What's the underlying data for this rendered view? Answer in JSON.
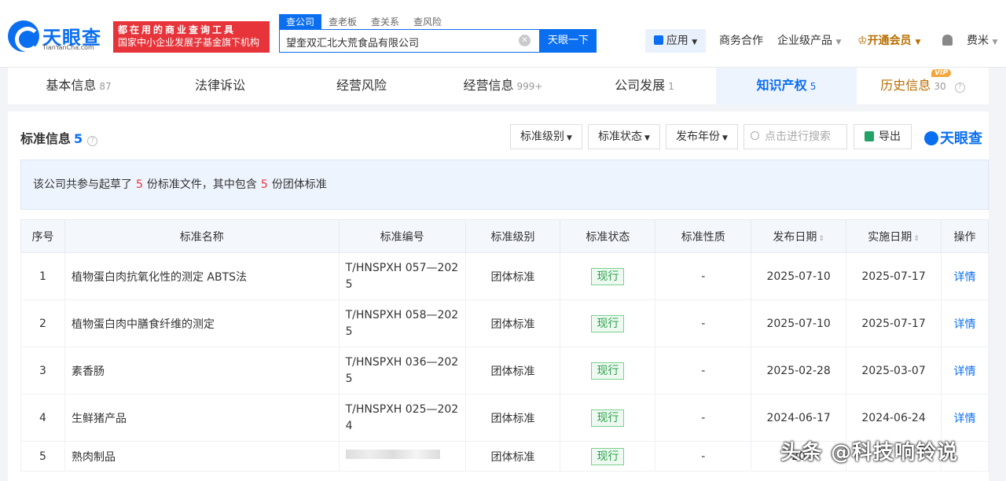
{
  "header": {
    "logo_text": "天眼查",
    "logo_sub": "TianYanCha.com",
    "promo_line1": "都在用的商业查询工具",
    "promo_line2": "国家中小企业发展子基金旗下机构",
    "search_tabs": [
      "查公司",
      "查老板",
      "查关系",
      "查风险"
    ],
    "search_value": "望奎双汇北大荒食品有限公司",
    "search_button": "天眼一下",
    "apps_label": "应用",
    "business": "商务合作",
    "enterprise": "企业级产品",
    "vip_label": "开通会员",
    "user_name": "费米"
  },
  "tabs": [
    {
      "label": "基本信息",
      "count": "87"
    },
    {
      "label": "法律诉讼",
      "count": ""
    },
    {
      "label": "经营风险",
      "count": ""
    },
    {
      "label": "经营信息",
      "count": "999+"
    },
    {
      "label": "公司发展",
      "count": "1"
    },
    {
      "label": "知识产权",
      "count": "5"
    },
    {
      "label": "历史信息",
      "count": "30"
    }
  ],
  "vip_badge": "VIP",
  "section": {
    "title": "标准信息",
    "count": "5",
    "filters": [
      "标准级别",
      "标准状态",
      "发布年份"
    ],
    "search_placeholder": "点击进行搜索",
    "export_label": "导出",
    "brand": "天眼查",
    "summary_prefix": "该公司共参与起草了",
    "summary_count1": "5",
    "summary_mid": "份标准文件，其中包含",
    "summary_count2": "5",
    "summary_suffix": "份团体标准"
  },
  "table": {
    "headers": [
      "序号",
      "标准名称",
      "标准编号",
      "标准级别",
      "标准状态",
      "标准性质",
      "发布日期",
      "实施日期",
      "操作"
    ],
    "rows": [
      {
        "no": "1",
        "name": "植物蛋白肉抗氧化性的测定 ABTS法",
        "code": "T/HNSPXH 057—2025",
        "level": "团体标准",
        "status": "现行",
        "nature": "-",
        "pub": "2025-07-10",
        "impl": "2025-07-17",
        "action": "详情"
      },
      {
        "no": "2",
        "name": "植物蛋白肉中膳食纤维的测定",
        "code": "T/HNSPXH 058—2025",
        "level": "团体标准",
        "status": "现行",
        "nature": "-",
        "pub": "2025-07-10",
        "impl": "2025-07-17",
        "action": "详情"
      },
      {
        "no": "3",
        "name": "素香肠",
        "code": "T/HNSPXH 036—2025",
        "level": "团体标准",
        "status": "现行",
        "nature": "-",
        "pub": "2025-02-28",
        "impl": "2025-03-07",
        "action": "详情"
      },
      {
        "no": "4",
        "name": "生鲜猪产品",
        "code": "T/HNSPXH 025—2024",
        "level": "团体标准",
        "status": "现行",
        "nature": "-",
        "pub": "2024-06-17",
        "impl": "2024-06-24",
        "action": "详情"
      },
      {
        "no": "5",
        "name": "熟肉制品",
        "code": "",
        "level": "团体标准",
        "status": "现行",
        "nature": "-",
        "pub": "20",
        "impl": "",
        "action": ""
      }
    ]
  },
  "watermark": "头条 @科技响铃说"
}
